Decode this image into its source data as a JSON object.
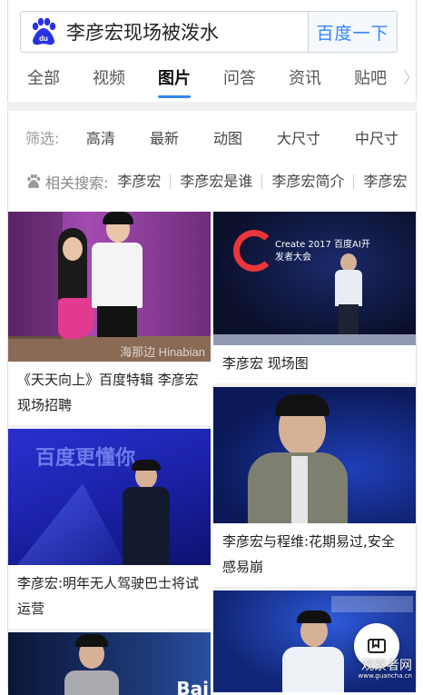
{
  "search": {
    "query": "李彦宏现场被泼水",
    "button_label": "百度一下"
  },
  "tabs": [
    {
      "label": "全部"
    },
    {
      "label": "视频"
    },
    {
      "label": "图片"
    },
    {
      "label": "问答"
    },
    {
      "label": "资讯"
    },
    {
      "label": "贴吧"
    }
  ],
  "active_tab": "图片",
  "filters": {
    "label": "筛选:",
    "items": [
      "高清",
      "最新",
      "动图",
      "大尺寸",
      "中尺寸"
    ]
  },
  "related": {
    "label": "相关搜索:",
    "items": [
      "李彦宏",
      "李彦宏是谁",
      "李彦宏简介",
      "李彦宏"
    ]
  },
  "results": {
    "left": [
      {
        "caption": "《天天向上》百度特辑 李彦宏现场招聘",
        "overlay_text": "海那边 Hinabian"
      },
      {
        "caption": "李彦宏:明年无人驾驶巴士将试运营",
        "overlay_text": "百度更懂你"
      },
      {
        "caption": "",
        "overlay_text": "Bai"
      }
    ],
    "right": [
      {
        "caption": "李彦宏 现场图",
        "overlay_text": "Create 2017 百度AI开发者大会"
      },
      {
        "caption": "李彦宏与程维:花期易过,安全感易崩",
        "overlay_text": ""
      },
      {
        "caption": "",
        "overlay_text": ""
      }
    ]
  },
  "watermark": {
    "text": "观察者网",
    "url": "www.guancha.cn"
  },
  "colors": {
    "accent": "#3385ff"
  }
}
